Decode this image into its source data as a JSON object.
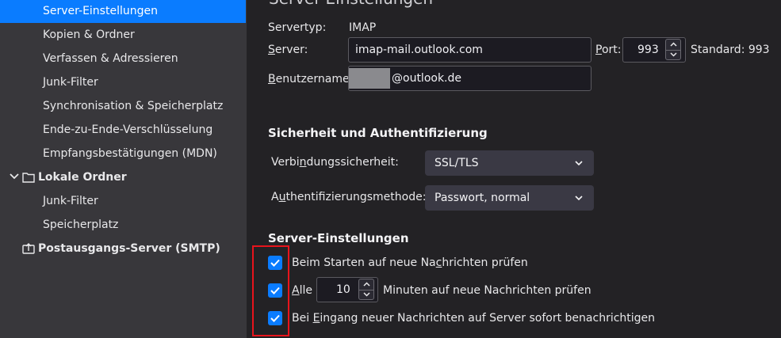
{
  "sidebar": {
    "items": [
      {
        "label": "Server-Einstellungen",
        "selected": true
      },
      {
        "label": "Kopien & Ordner"
      },
      {
        "label": "Verfassen & Adressieren"
      },
      {
        "label": "Junk-Filter"
      },
      {
        "label": "Synchronisation & Speicherplatz"
      },
      {
        "label": "Ende-zu-Ende-Verschlüsselung"
      },
      {
        "label": "Empfangsbestätigungen (MDN)"
      }
    ],
    "local_folders": {
      "label": "Lokale Ordner",
      "icon": "folder-icon",
      "items": [
        {
          "label": "Junk-Filter"
        },
        {
          "label": "Speicherplatz"
        }
      ]
    },
    "smtp": {
      "label": "Postausgangs-Server (SMTP)",
      "icon": "outbox-icon"
    }
  },
  "main": {
    "title": "Server-Einstellungen",
    "servertype_label": "Servertyp:",
    "servertype_value": "IMAP",
    "server": {
      "label_first": "S",
      "label_rest": "erver:",
      "value": "imap-mail.outlook.com"
    },
    "port": {
      "label_first": "P",
      "label_rest": "ort:",
      "value": "993",
      "default_text": "Standard: 993"
    },
    "username": {
      "label_first": "B",
      "label_rest": "enutzername:",
      "value_suffix": "@outlook.de"
    },
    "security": {
      "title": "Sicherheit und Authentifizierung",
      "connection_label_a": "Verbi",
      "connection_label_u": "n",
      "connection_label_b": "dungssicherheit:",
      "connection_value": "SSL/TLS",
      "auth_label_a": "A",
      "auth_label_u": "u",
      "auth_label_b": "thentifizierungsmethode:",
      "auth_value": "Passwort, normal"
    },
    "server_settings": {
      "title": "Server-Einstellungen",
      "check_startup_a": "Beim Starten auf neue Na",
      "check_startup_u": "c",
      "check_startup_b": "hrichten prüfen",
      "check_every_u": "A",
      "check_every_b": "lle",
      "check_every_minutes": "10",
      "check_every_suffix": "Minuten auf neue Nachrichten prüfen",
      "notify_a": "Bei ",
      "notify_u": "E",
      "notify_b": "ingang neuer Nachrichten auf Server sofort benachrichtigen",
      "checked": [
        true,
        true,
        true
      ]
    }
  },
  "colors": {
    "accent": "#0a7cff",
    "highlight_box": "#e8141c",
    "sidebar_bg": "#38373b",
    "pane_bg": "#232225"
  }
}
